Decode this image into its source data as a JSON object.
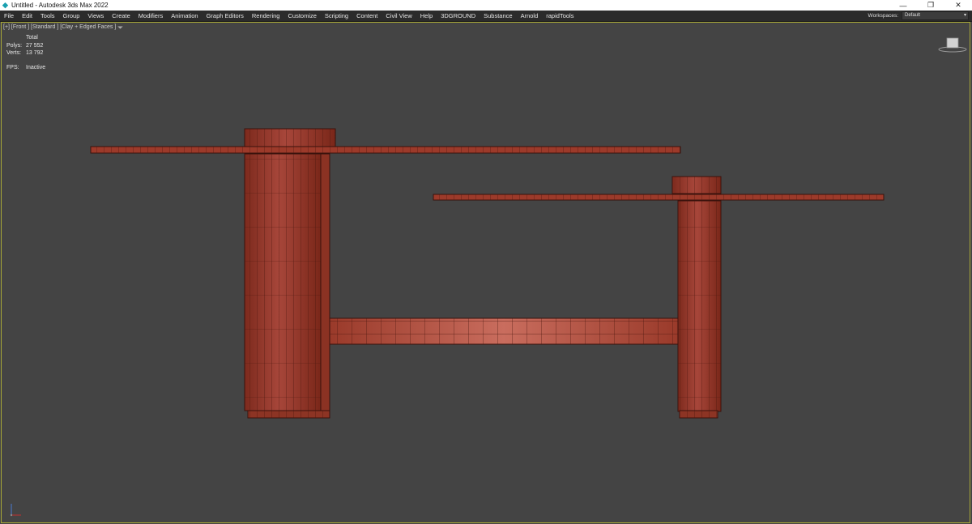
{
  "window": {
    "title": "Untitled - Autodesk 3ds Max 2022",
    "controls": {
      "minimize": "—",
      "restore": "❐",
      "close": "✕"
    }
  },
  "menu": {
    "items": [
      "File",
      "Edit",
      "Tools",
      "Group",
      "Views",
      "Create",
      "Modifiers",
      "Animation",
      "Graph Editors",
      "Rendering",
      "Customize",
      "Scripting",
      "Content",
      "Civil View",
      "Help",
      "3DGROUND",
      "Substance",
      "Arnold",
      "rapidTools"
    ]
  },
  "workspace": {
    "label": "Workspaces:",
    "value": "Default"
  },
  "viewport": {
    "label": "[+] [Front ] [Standard ] [Clay + Edged Faces ]",
    "stats": {
      "header": "Total",
      "polys_label": "Polys:",
      "polys_value": "27 552",
      "verts_label": "Verts:",
      "verts_value": "13 792",
      "fps_label": "FPS:",
      "fps_value": "Inactive"
    }
  },
  "colors": {
    "viewport_bg": "#444444",
    "mesh_fill": "#9c3a2a",
    "mesh_edge": "#3a120c",
    "active_border": "#a8a838"
  }
}
